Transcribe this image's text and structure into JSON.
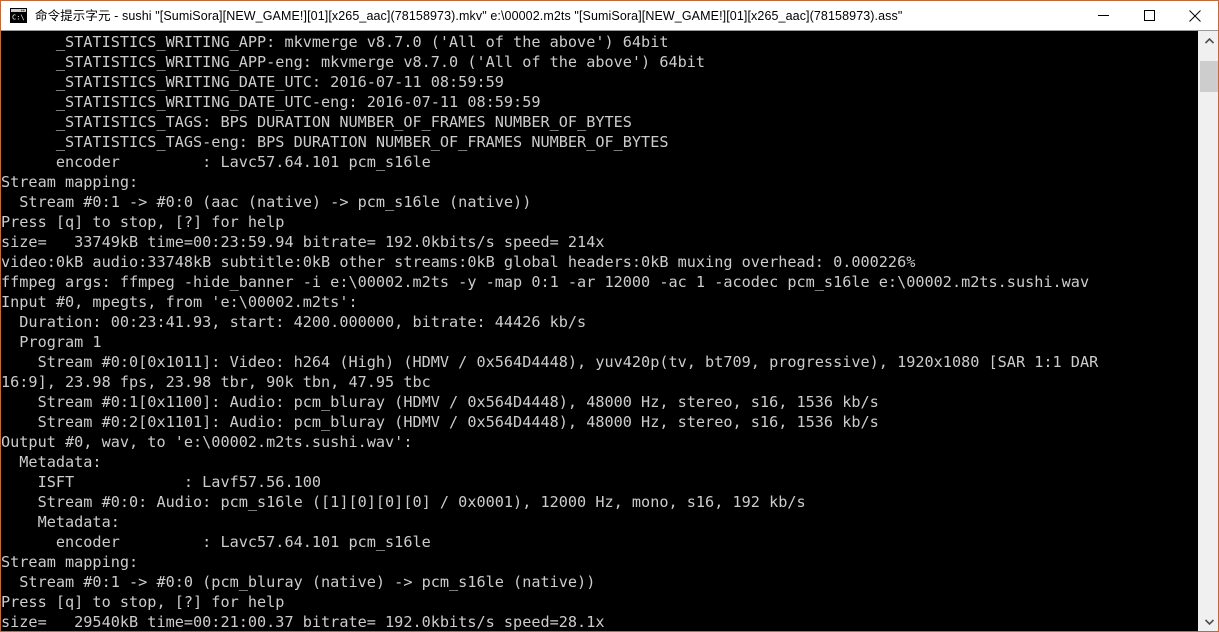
{
  "window": {
    "app_icon": "cmd-console-icon",
    "title": "命令提示字元 - sushi  \"[SumiSora][NEW_GAME!][01][x265_aac](78158973).mkv\" e:\\00002.m2ts \"[SumiSora][NEW_GAME!][01][x265_aac](78158973).ass\"",
    "border_color": "#c06a3c",
    "titlebar_bg": "#ffffff",
    "console_bg": "#000000",
    "console_fg": "#cccccc",
    "buttons": {
      "minimize_label": "Minimize",
      "maximize_label": "Maximize",
      "close_label": "Close"
    }
  },
  "scrollbar": {
    "up_arrow_label": "Scroll up",
    "down_arrow_label": "Scroll down",
    "thumb_label": "Scrollbar thumb"
  },
  "console": {
    "lines": [
      "      _STATISTICS_WRITING_APP: mkvmerge v8.7.0 ('All of the above') 64bit",
      "      _STATISTICS_WRITING_APP-eng: mkvmerge v8.7.0 ('All of the above') 64bit",
      "      _STATISTICS_WRITING_DATE_UTC: 2016-07-11 08:59:59",
      "      _STATISTICS_WRITING_DATE_UTC-eng: 2016-07-11 08:59:59",
      "      _STATISTICS_TAGS: BPS DURATION NUMBER_OF_FRAMES NUMBER_OF_BYTES",
      "      _STATISTICS_TAGS-eng: BPS DURATION NUMBER_OF_FRAMES NUMBER_OF_BYTES",
      "      encoder         : Lavc57.64.101 pcm_s16le",
      "Stream mapping:",
      "  Stream #0:1 -> #0:0 (aac (native) -> pcm_s16le (native))",
      "Press [q] to stop, [?] for help",
      "size=   33749kB time=00:23:59.94 bitrate= 192.0kbits/s speed= 214x",
      "video:0kB audio:33748kB subtitle:0kB other streams:0kB global headers:0kB muxing overhead: 0.000226%",
      "ffmpeg args: ffmpeg -hide_banner -i e:\\00002.m2ts -y -map 0:1 -ar 12000 -ac 1 -acodec pcm_s16le e:\\00002.m2ts.sushi.wav",
      "Input #0, mpegts, from 'e:\\00002.m2ts':",
      "  Duration: 00:23:41.93, start: 4200.000000, bitrate: 44426 kb/s",
      "  Program 1",
      "    Stream #0:0[0x1011]: Video: h264 (High) (HDMV / 0x564D4448), yuv420p(tv, bt709, progressive), 1920x1080 [SAR 1:1 DAR",
      "16:9], 23.98 fps, 23.98 tbr, 90k tbn, 47.95 tbc",
      "    Stream #0:1[0x1100]: Audio: pcm_bluray (HDMV / 0x564D4448), 48000 Hz, stereo, s16, 1536 kb/s",
      "    Stream #0:2[0x1101]: Audio: pcm_bluray (HDMV / 0x564D4448), 48000 Hz, stereo, s16, 1536 kb/s",
      "Output #0, wav, to 'e:\\00002.m2ts.sushi.wav':",
      "  Metadata:",
      "    ISFT            : Lavf57.56.100",
      "    Stream #0:0: Audio: pcm_s16le ([1][0][0][0] / 0x0001), 12000 Hz, mono, s16, 192 kb/s",
      "    Metadata:",
      "      encoder         : Lavc57.64.101 pcm_s16le",
      "Stream mapping:",
      "  Stream #0:1 -> #0:0 (pcm_bluray (native) -> pcm_s16le (native))",
      "Press [q] to stop, [?] for help",
      "size=   29540kB time=00:21:00.37 bitrate= 192.0kbits/s speed=28.1x"
    ]
  }
}
